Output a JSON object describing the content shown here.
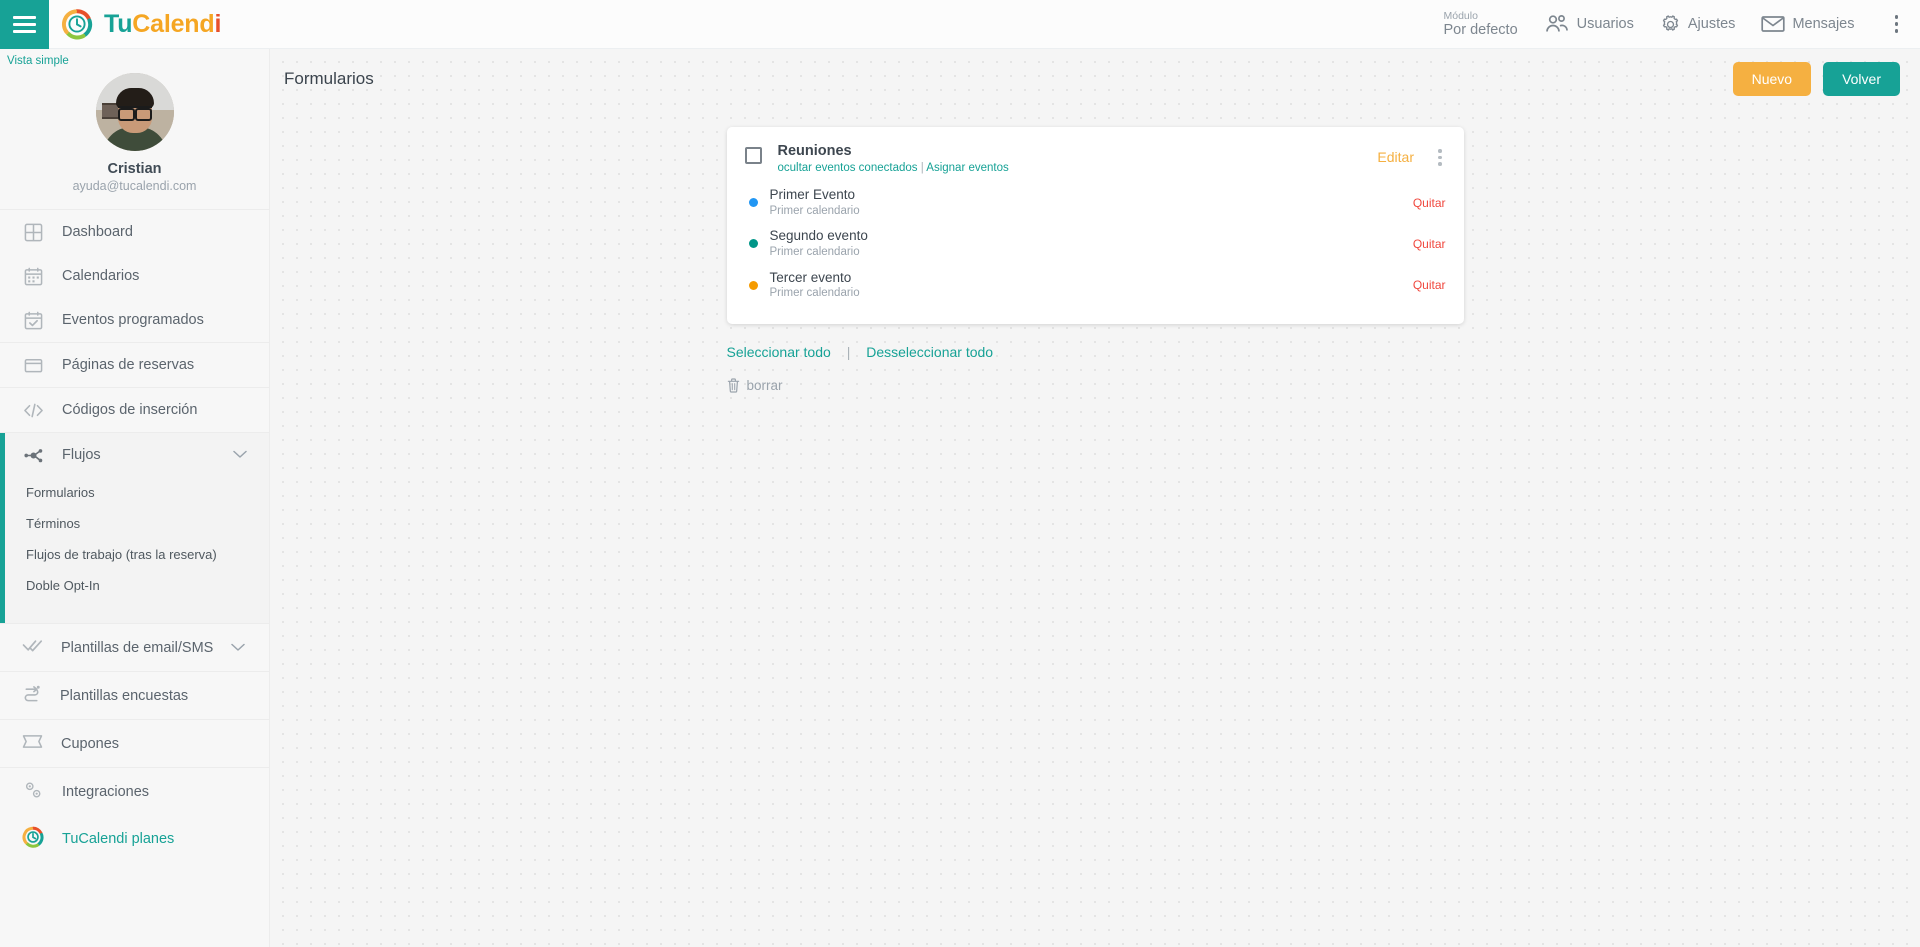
{
  "topbar": {
    "menu_icon": "hamburger-icon",
    "brand": {
      "part1": "Tu",
      "part2": "Calend",
      "part3": "i"
    },
    "module": {
      "label": "Módulo",
      "value": "Por defecto"
    },
    "items": [
      {
        "label": "Usuarios",
        "icon": "users-icon"
      },
      {
        "label": "Ajustes",
        "icon": "gear-icon"
      },
      {
        "label": "Mensajes",
        "icon": "envelope-icon"
      }
    ],
    "overflow_icon": "kebab-vertical-icon"
  },
  "sidebar": {
    "vista_simple": "Vista simple",
    "profile": {
      "name": "Cristian",
      "email": "ayuda@tucalendi.com",
      "avatar": "user-avatar"
    },
    "items": [
      {
        "label": "Dashboard",
        "icon": "grid-icon"
      },
      {
        "label": "Calendarios",
        "icon": "calendar-icon"
      },
      {
        "label": "Eventos programados",
        "icon": "calendar-check-icon"
      },
      {
        "label": "Páginas de reservas",
        "icon": "window-icon"
      },
      {
        "label": "Códigos de inserción",
        "icon": "code-icon"
      }
    ],
    "flujos": {
      "label": "Flujos",
      "icon": "flow-nodes-icon",
      "chevron": "chevron-down-icon",
      "subitems": [
        {
          "label": "Formularios"
        },
        {
          "label": "Términos"
        },
        {
          "label": "Flujos de trabajo (tras la reserva)"
        },
        {
          "label": "Doble Opt-In"
        }
      ]
    },
    "bottom_items": [
      {
        "label": "Plantillas de email/SMS",
        "icon": "double-check-icon",
        "chevron": "chevron-down-icon"
      },
      {
        "label": "Plantillas encuestas",
        "icon": "survey-flow-icon"
      },
      {
        "label": "Cupones",
        "icon": "ticket-icon"
      },
      {
        "label": "Integraciones",
        "icon": "gears-icon"
      },
      {
        "label": "TuCalendi planes",
        "icon": "tucalendi-logo-icon"
      }
    ]
  },
  "main": {
    "page_title": "Formularios",
    "buttons": {
      "new": "Nuevo",
      "back": "Volver"
    },
    "card": {
      "title": "Reuniones",
      "sublinks": {
        "hide": "ocultar eventos conectados",
        "separator": "|",
        "assign": "Asignar eventos"
      },
      "edit_label": "Editar",
      "kebab_icon": "kebab-vertical-icon",
      "events": [
        {
          "name": "Primer Evento",
          "calendar": "Primer calendario",
          "color": "#2196f3",
          "remove_label": "Quitar"
        },
        {
          "name": "Segundo evento",
          "calendar": "Primer calendario",
          "color": "#009688",
          "remove_label": "Quitar"
        },
        {
          "name": "Tercer evento",
          "calendar": "Primer calendario",
          "color": "#f59b00",
          "remove_label": "Quitar"
        }
      ]
    },
    "select_all": "Seleccionar todo",
    "select_separator": "|",
    "deselect_all": "Desseleccionar todo",
    "delete": {
      "label": "borrar",
      "icon": "trash-icon"
    }
  },
  "colors": {
    "brand_teal": "#17a296",
    "brand_orange": "#f5b041",
    "brand_red": "#e8502a",
    "danger": "#f0483e"
  }
}
